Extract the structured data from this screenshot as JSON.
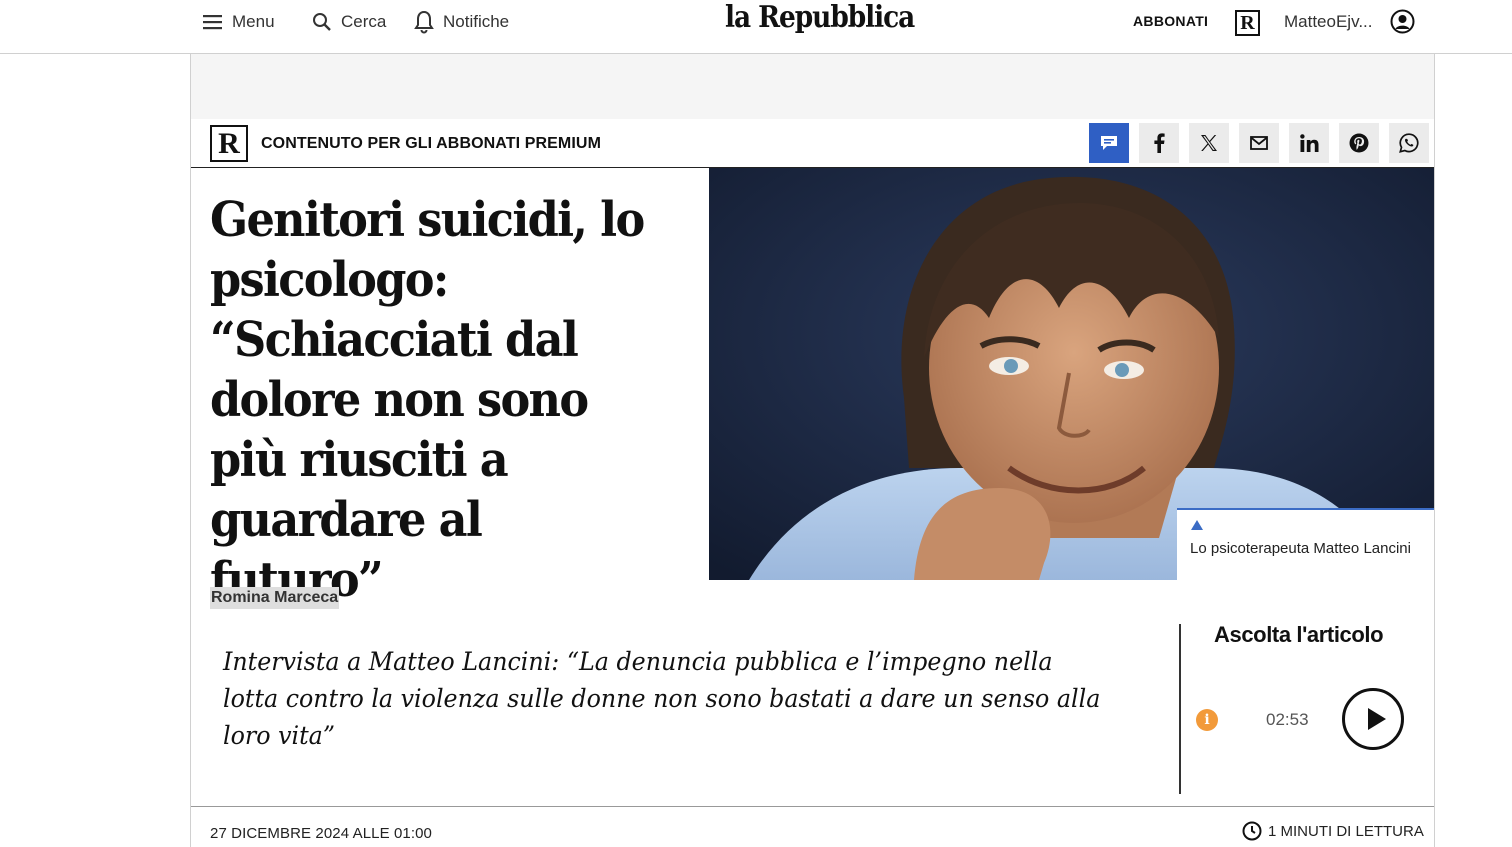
{
  "header": {
    "menu_label": "Menu",
    "search_label": "Cerca",
    "notifications_label": "Notifiche",
    "logo": "la Repubblica",
    "subscribe_label": "ABBONATI",
    "r_mark": "R",
    "user_name": "MatteoEjv..."
  },
  "premium": {
    "r_mark": "R",
    "label": "CONTENUTO PER GLI ABBONATI PREMIUM",
    "share_buttons": [
      "comment-icon",
      "facebook-icon",
      "x-icon",
      "mail-icon",
      "linkedin-icon",
      "pinterest-icon",
      "whatsapp-icon"
    ]
  },
  "article": {
    "headline": "Genitori suicidi, lo psicologo: “Schiacciati dal dolore non sono più riusciti a guardare al futuro”",
    "photo_caption": "Lo psicoterapeuta Matteo Lancini",
    "author": "Romina Marceca",
    "summary": "Intervista a Matteo Lancini: “La denuncia pubblica e l’impegno nella lotta contro la violenza sulle donne non sono bastati a dare un senso alla loro vita”",
    "date": "27 DICEMBRE 2024 ALLE 01:00",
    "reading_time": "1 MINUTI DI LETTURA"
  },
  "audio": {
    "title": "Ascolta l'articolo",
    "info_glyph": "i",
    "duration": "02:53"
  },
  "colors": {
    "comment_button": "#2f5fc4",
    "caption_accent": "#3b6cc5",
    "info_icon": "#f29a3a"
  }
}
